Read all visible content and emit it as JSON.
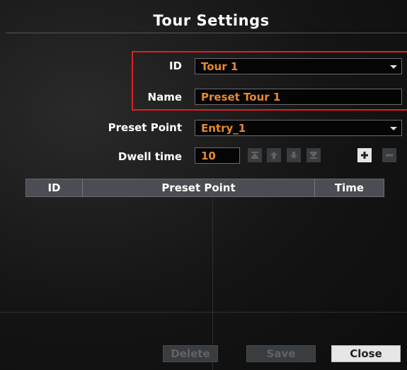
{
  "dialog": {
    "title": "Tour Settings",
    "fields": {
      "id_label": "ID",
      "id_value": "Tour 1",
      "name_label": "Name",
      "name_value": "Preset Tour 1",
      "preset_label": "Preset Point",
      "preset_value": "Entry_1",
      "dwell_label": "Dwell time",
      "dwell_value": "10"
    },
    "table": {
      "headers": [
        "ID",
        "Preset Point",
        "Time"
      ],
      "rows": []
    },
    "buttons": {
      "delete": "Delete",
      "save": "Save",
      "close": "Close"
    }
  },
  "icons": [
    "move-top-icon",
    "move-up-icon",
    "move-down-icon",
    "move-bottom-icon",
    "add-icon",
    "remove-icon"
  ],
  "colors": {
    "value_text": "#e8892c",
    "highlight_border": "#e21d23",
    "header_bg": "#4a4d52"
  }
}
